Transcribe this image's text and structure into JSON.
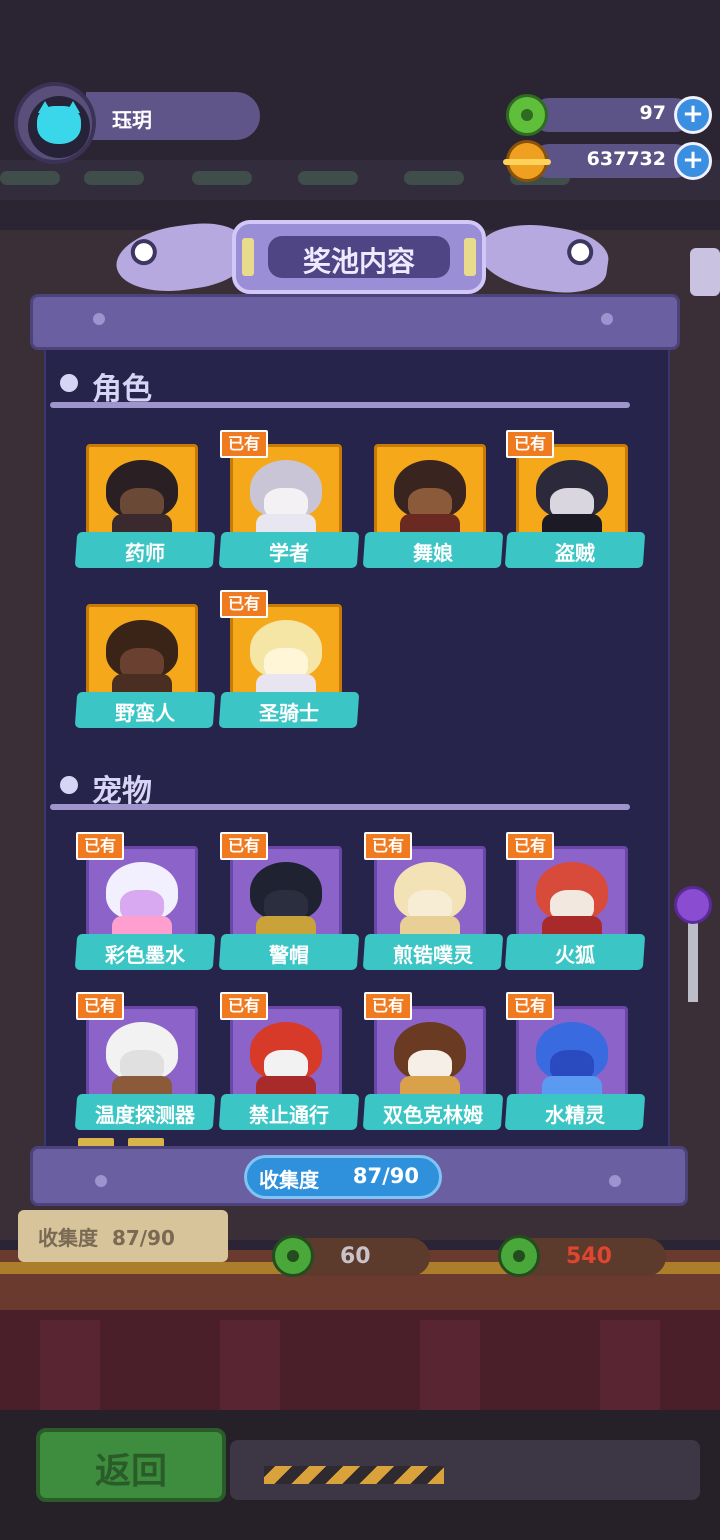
{
  "player": {
    "name": "珏玥"
  },
  "currency": {
    "donuts": "97",
    "coins": "637732"
  },
  "panel": {
    "title": "奖池内容",
    "sections": {
      "characters": {
        "title": "角色"
      },
      "pets": {
        "title": "宠物"
      }
    },
    "owned_badge": "已有",
    "characters": [
      {
        "name": "药师",
        "owned": false
      },
      {
        "name": "学者",
        "owned": true
      },
      {
        "name": "舞娘",
        "owned": false
      },
      {
        "name": "盗贼",
        "owned": true
      },
      {
        "name": "野蛮人",
        "owned": false
      },
      {
        "name": "圣骑士",
        "owned": true
      }
    ],
    "pets": [
      {
        "name": "彩色墨水",
        "owned": true
      },
      {
        "name": "警帽",
        "owned": true
      },
      {
        "name": "煎锆噗灵",
        "owned": true
      },
      {
        "name": "火狐",
        "owned": true
      },
      {
        "name": "温度探测器",
        "owned": true
      },
      {
        "name": "禁止通行",
        "owned": true
      },
      {
        "name": "双色克林姆",
        "owned": true
      },
      {
        "name": "水精灵",
        "owned": true
      }
    ],
    "collection": {
      "label": "收集度",
      "value": "87/90"
    }
  },
  "background": {
    "shelf_label": "收集度",
    "shelf_value": "87/90",
    "price_left": "60",
    "price_right": "540"
  },
  "back_button": {
    "label": "返回"
  },
  "colors": {
    "accent_teal": "#3cc5c5",
    "owned_orange": "#ef7a1f",
    "panel_purple": "#6a5fa0",
    "collect_blue": "#2f91dc"
  }
}
